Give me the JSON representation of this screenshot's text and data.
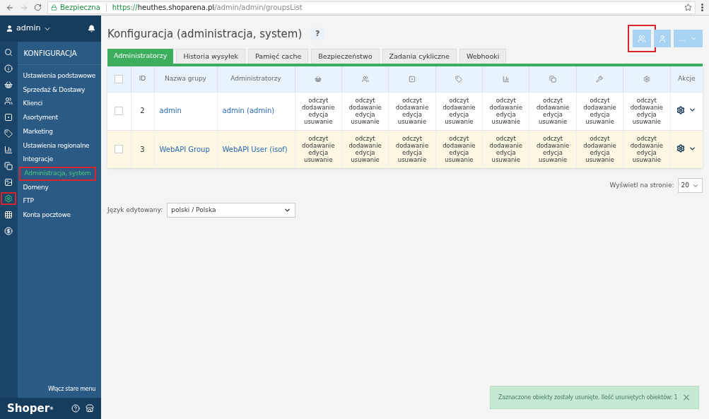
{
  "browser": {
    "secure_label": "Bezpieczna",
    "url_scheme": "https://",
    "url_host": "heuthes.shoparena.pl",
    "url_path": "/admin/admin/groupsList"
  },
  "user": {
    "name": "admin"
  },
  "rail": [
    {
      "selected": false
    },
    {
      "selected": false
    },
    {
      "selected": false
    },
    {
      "selected": false
    },
    {
      "selected": false
    },
    {
      "selected": false
    },
    {
      "selected": false
    },
    {
      "selected": false
    },
    {
      "selected": false
    },
    {
      "selected": true
    },
    {
      "selected": false
    },
    {
      "selected": false
    }
  ],
  "menu": {
    "heading": "KONFIGURACJA",
    "items": [
      {
        "label": "Ustawienia podstawowe",
        "selected": false
      },
      {
        "label": "Sprzedaż & Dostawy",
        "selected": false
      },
      {
        "label": "Klienci",
        "selected": false
      },
      {
        "label": "Asortyment",
        "selected": false
      },
      {
        "label": "Marketing",
        "selected": false
      },
      {
        "label": "Ustawienia regionalne",
        "selected": false
      },
      {
        "label": "Integracje",
        "selected": false
      },
      {
        "label": "Administracja, system",
        "selected": true
      },
      {
        "label": "Domeny",
        "selected": false
      },
      {
        "label": "FTP",
        "selected": false
      },
      {
        "label": "Konta pocztowe",
        "selected": false
      }
    ],
    "footer_link": "Włącz stare menu"
  },
  "brand": {
    "name": "Shoper",
    "mark": "®"
  },
  "page": {
    "title": "Konfiguracja (administracja, system)",
    "help": "?"
  },
  "toolbar": {
    "buttons": [
      {
        "kind": "group",
        "highlighted": true
      },
      {
        "kind": "user",
        "highlighted": false
      },
      {
        "kind": "more",
        "label": "...",
        "highlighted": false
      }
    ]
  },
  "tabs": [
    {
      "label": "Administratorzy",
      "selected": true
    },
    {
      "label": "Historia wysyłek",
      "selected": false
    },
    {
      "label": "Pamięć cache",
      "selected": false
    },
    {
      "label": "Bezpieczeństwo",
      "selected": false
    },
    {
      "label": "Zadania cykliczne",
      "selected": false
    },
    {
      "label": "Webhooki",
      "selected": false
    }
  ],
  "table": {
    "select_all_checked": false,
    "columns": {
      "id": "ID",
      "name": "Nazwa grupy",
      "admins": "Administratorzy",
      "actions": "Akcje"
    },
    "rows": [
      {
        "checked": false,
        "id": "2",
        "name": "admin",
        "admins": "admin (admin)",
        "highlighted": false,
        "permissions": [
          [
            "odczyt",
            "dodawanie",
            "edycja",
            "usuwanie"
          ],
          [
            "odczyt",
            "dodawanie",
            "edycja",
            "usuwanie"
          ],
          [
            "odczyt",
            "dodawanie",
            "edycja",
            "usuwanie"
          ],
          [
            "odczyt",
            "dodawanie",
            "edycja",
            "usuwanie"
          ],
          [
            "odczyt",
            "dodawanie",
            "edycja",
            "usuwanie"
          ],
          [
            "odczyt",
            "dodawanie",
            "edycja",
            "usuwanie"
          ],
          [
            "odczyt",
            "dodawanie",
            "edycja",
            "usuwanie"
          ],
          [
            "odczyt",
            "dodawanie",
            "edycja",
            "usuwanie"
          ]
        ]
      },
      {
        "checked": false,
        "id": "3",
        "name": "WebAPI Group",
        "admins": "WebAPI User (isof)",
        "highlighted": true,
        "permissions": [
          [
            "odczyt",
            "dodawanie",
            "edycja",
            "usuwanie"
          ],
          [
            "odczyt",
            "dodawanie",
            "edycja",
            "usuwanie"
          ],
          [
            "odczyt",
            "dodawanie",
            "edycja",
            "usuwanie"
          ],
          [
            "odczyt",
            "dodawanie",
            "edycja",
            "usuwanie"
          ],
          [
            "odczyt",
            "dodawanie",
            "edycja",
            "usuwanie"
          ],
          [
            "odczyt",
            "dodawanie",
            "edycja",
            "usuwanie"
          ],
          [
            "odczyt",
            "dodawanie",
            "edycja",
            "usuwanie"
          ],
          [
            "odczyt",
            "dodawanie",
            "edycja",
            "usuwanie"
          ]
        ]
      }
    ]
  },
  "pagination": {
    "label": "Wyświetl na stronie:",
    "value": "20"
  },
  "language": {
    "label": "Język edytowany:",
    "value": "polski / Polska"
  },
  "toast": {
    "message": "Zaznaczone obiekty zostały usunięte. Ilość usuniętych obiektów: 1",
    "close": "×"
  }
}
